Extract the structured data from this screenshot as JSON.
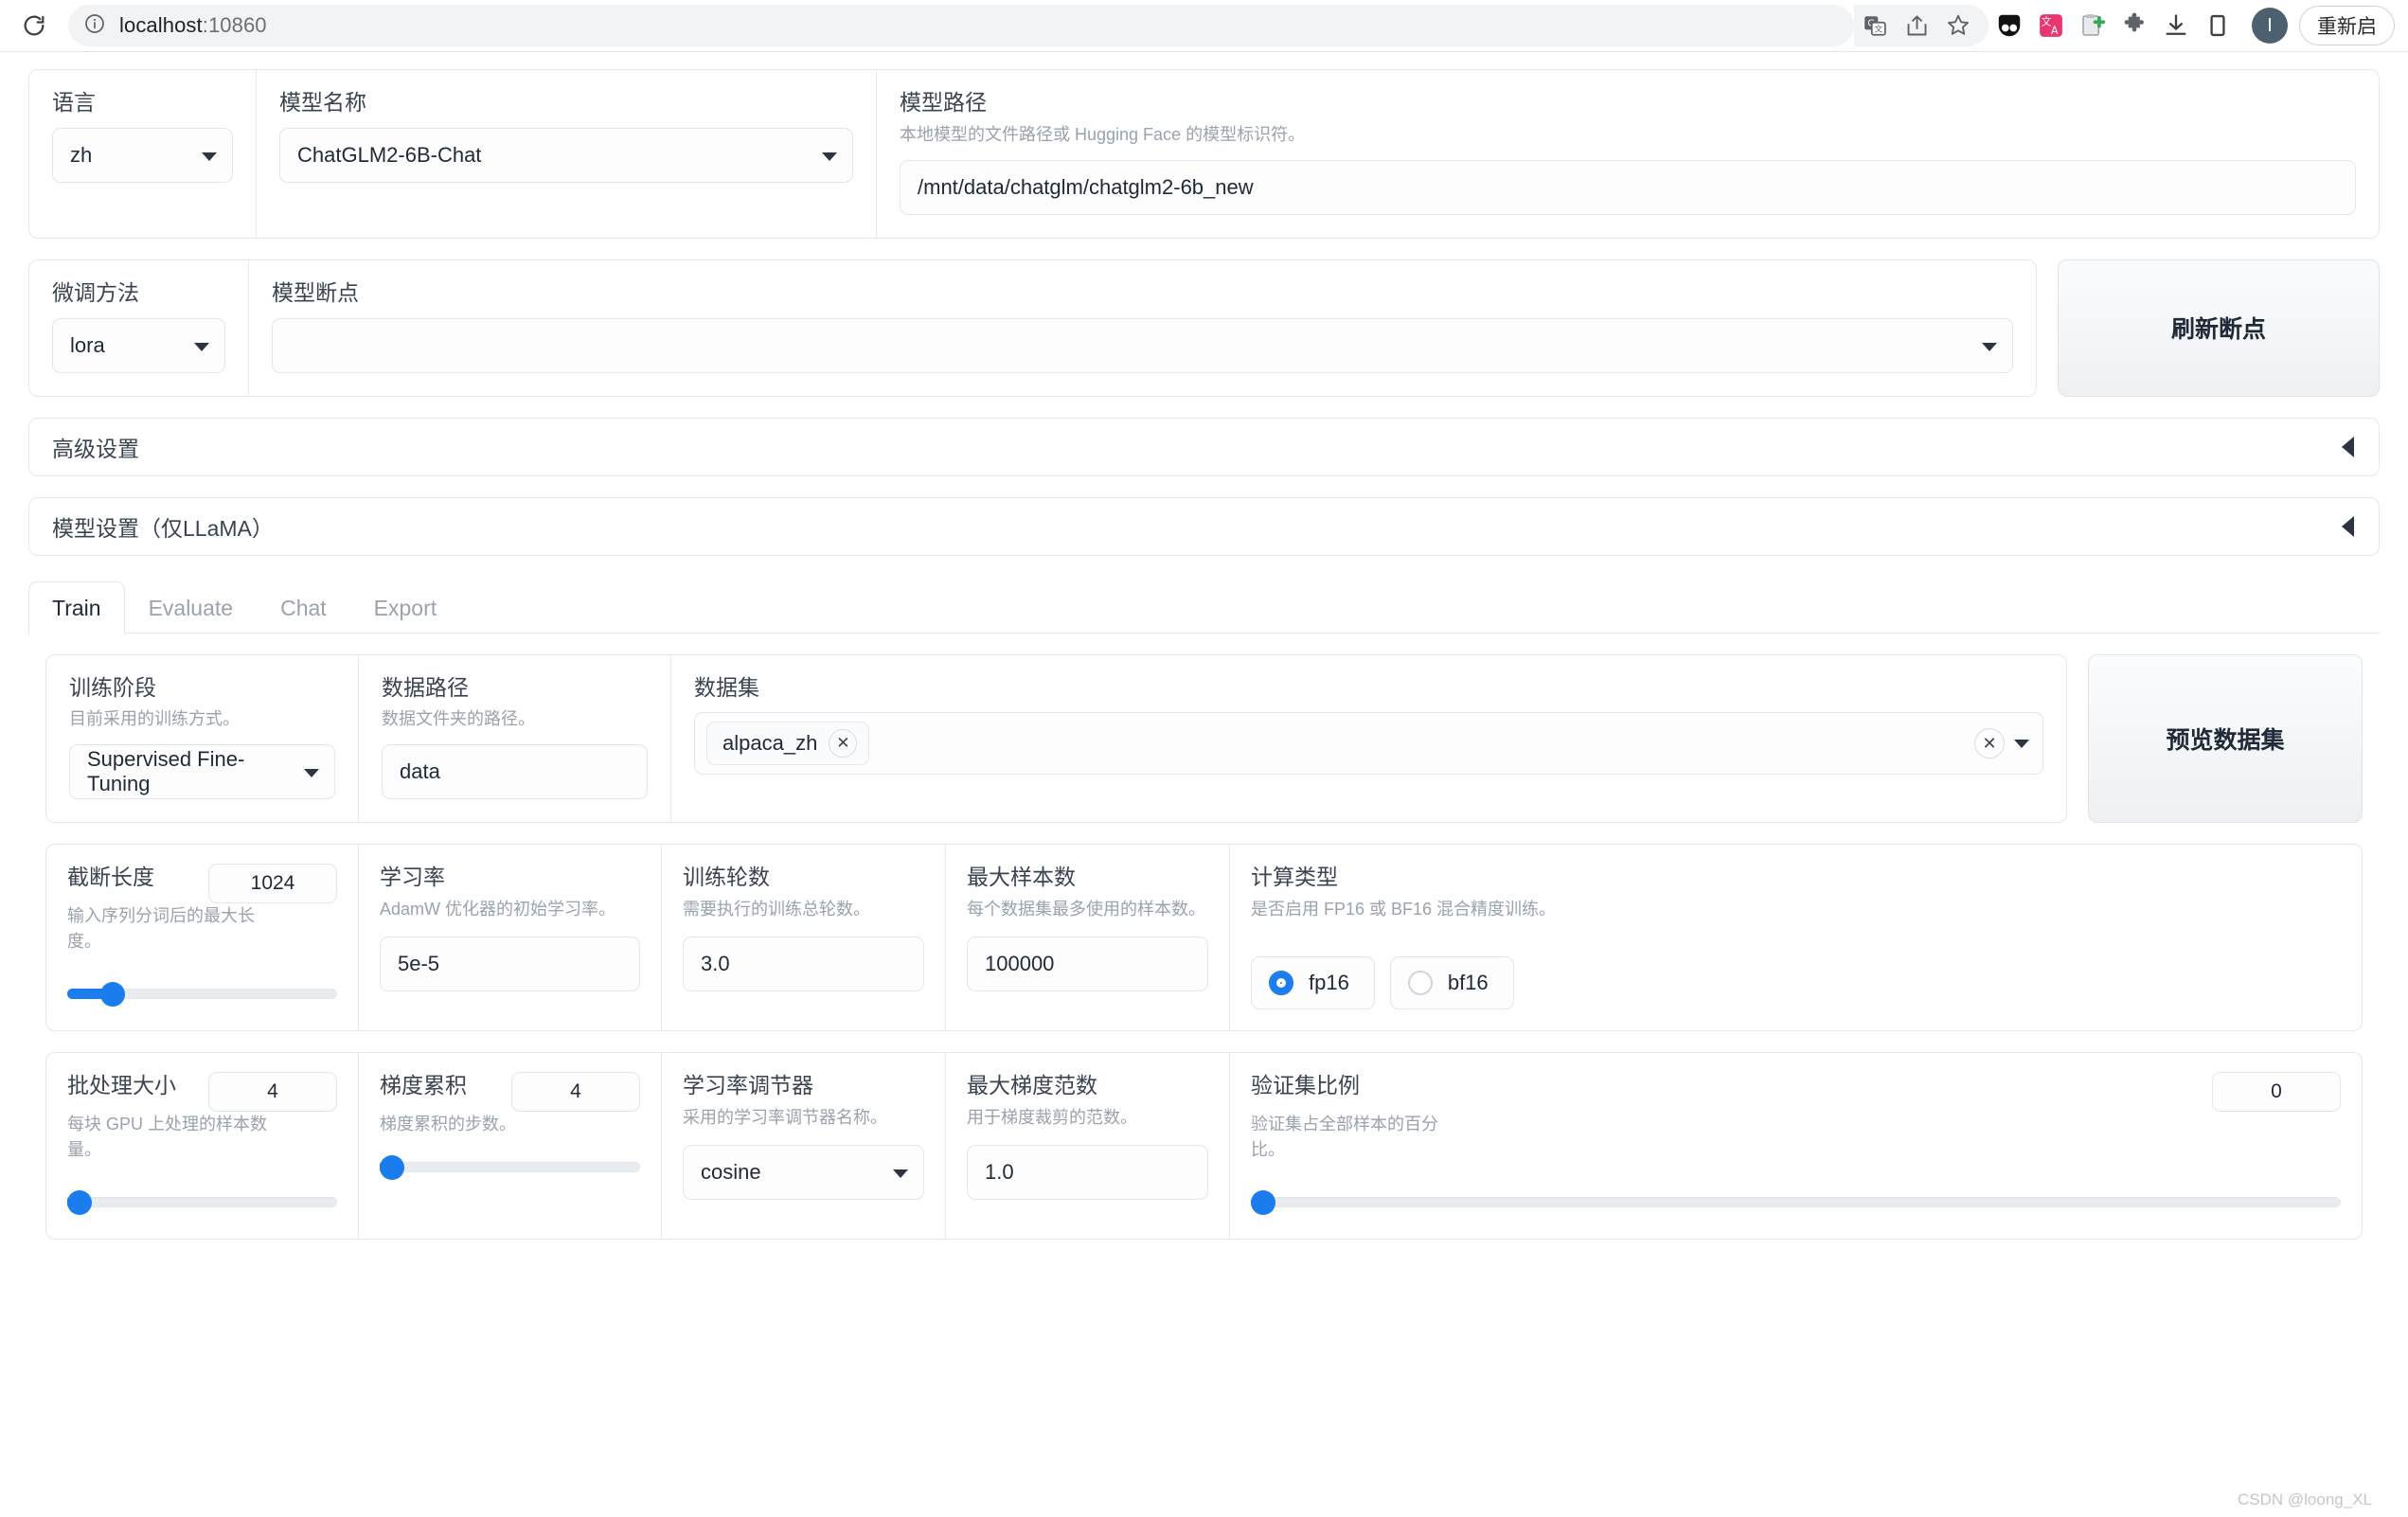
{
  "browser": {
    "reload_icon": "reload-icon",
    "info_icon": "site-info-icon",
    "url_main": "localhost",
    "url_port": ":10860",
    "update_button_label": "重新启",
    "avatar_letter": "I",
    "omnibox_icons": [
      "translate-icon",
      "share-icon",
      "bookmark-star-icon"
    ],
    "extension_icons": [
      "panda-extension-icon",
      "translate-extension-icon",
      "clipboard-add-icon",
      "puzzle-extensions-icon",
      "download-icon",
      "side-panel-icon"
    ]
  },
  "top": {
    "language": {
      "label": "语言",
      "value": "zh"
    },
    "model_name": {
      "label": "模型名称",
      "value": "ChatGLM2-6B-Chat"
    },
    "model_path": {
      "label": "模型路径",
      "desc": "本地模型的文件路径或 Hugging Face 的模型标识符。",
      "value": "/mnt/data/chatglm/chatglm2-6b_new"
    }
  },
  "second": {
    "finetune_method": {
      "label": "微调方法",
      "value": "lora"
    },
    "checkpoint": {
      "label": "模型断点",
      "value": ""
    },
    "refresh_button": "刷新断点"
  },
  "accordions": [
    {
      "label": "高级设置"
    },
    {
      "label": "模型设置（仅LLaMA）"
    }
  ],
  "tabs": [
    {
      "label": "Train",
      "active": true
    },
    {
      "label": "Evaluate",
      "active": false
    },
    {
      "label": "Chat",
      "active": false
    },
    {
      "label": "Export",
      "active": false
    }
  ],
  "train": {
    "stage": {
      "label": "训练阶段",
      "desc": "目前采用的训练方式。",
      "value": "Supervised Fine-Tuning"
    },
    "data_dir": {
      "label": "数据路径",
      "desc": "数据文件夹的路径。",
      "value": "data"
    },
    "dataset": {
      "label": "数据集",
      "chips": [
        "alpaca_zh"
      ],
      "clear_icon": "clear-icon",
      "caret_icon": "chevron-down-icon"
    },
    "preview_button": "预览数据集",
    "params_row1": [
      {
        "label": "截断长度",
        "desc": "输入序列分词后的最大长度。",
        "value": "1024",
        "control": "slider",
        "percent": 17
      },
      {
        "label": "学习率",
        "desc": "AdamW 优化器的初始学习率。",
        "value": "5e-5",
        "control": "text"
      },
      {
        "label": "训练轮数",
        "desc": "需要执行的训练总轮数。",
        "value": "3.0",
        "control": "text"
      },
      {
        "label": "最大样本数",
        "desc": "每个数据集最多使用的样本数。",
        "value": "100000",
        "control": "text"
      },
      {
        "label": "计算类型",
        "desc": "是否启用 FP16 或 BF16 混合精度训练。",
        "control": "radio",
        "options": [
          {
            "label": "fp16",
            "selected": true
          },
          {
            "label": "bf16",
            "selected": false
          }
        ]
      }
    ],
    "params_row2": [
      {
        "label": "批处理大小",
        "desc": "每块 GPU 上处理的样本数量。",
        "value": "4",
        "control": "slider",
        "percent": 2
      },
      {
        "label": "梯度累积",
        "desc": "梯度累积的步数。",
        "value": "4",
        "control": "slider",
        "percent": 2
      },
      {
        "label": "学习率调节器",
        "desc": "采用的学习率调节器名称。",
        "value": "cosine",
        "control": "select"
      },
      {
        "label": "最大梯度范数",
        "desc": "用于梯度裁剪的范数。",
        "value": "1.0",
        "control": "text"
      },
      {
        "label": "验证集比例",
        "desc": "验证集占全部样本的百分比。",
        "value": "0",
        "control": "slider",
        "percent": 1
      }
    ]
  },
  "watermark": "CSDN @loong_XL"
}
